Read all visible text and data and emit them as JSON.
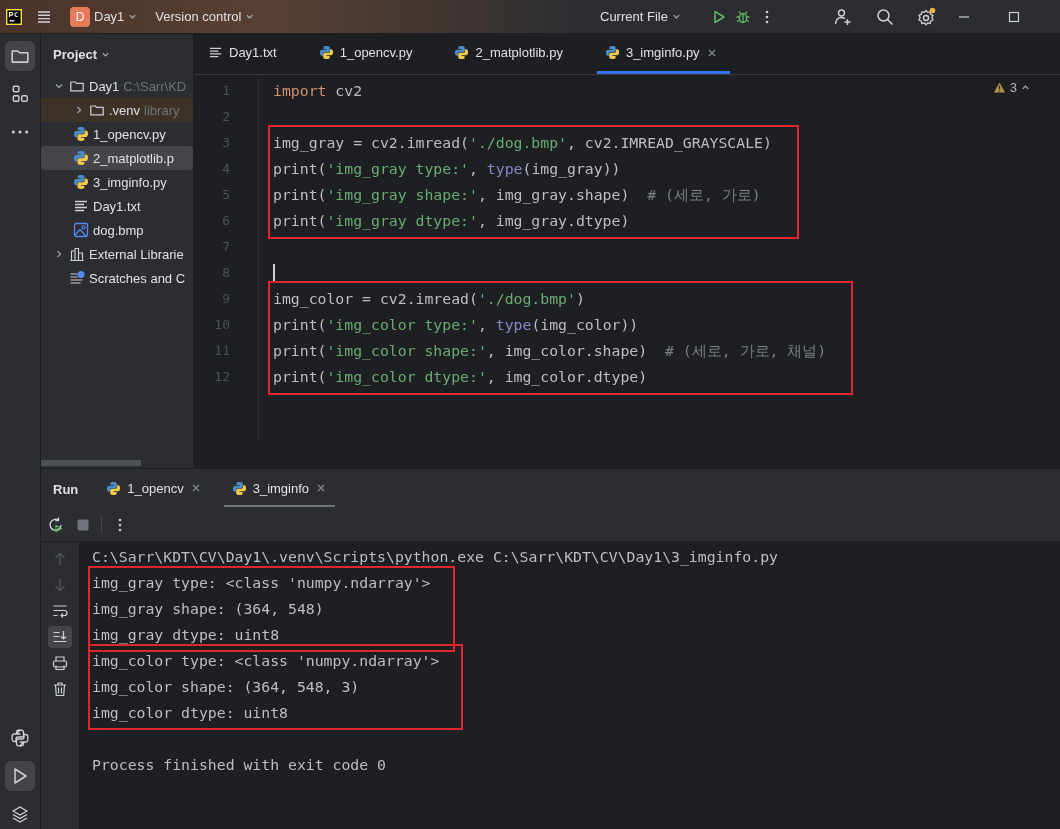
{
  "title_bar": {
    "project_initial": "D",
    "project": "Day1",
    "vcs": "Version control",
    "run_config": "Current File"
  },
  "left_toolbar": {
    "top": [
      {
        "kind": "folder",
        "selected": true
      },
      {
        "kind": "structure",
        "selected": false
      },
      {
        "kind": "more",
        "selected": false
      }
    ],
    "bottom": [
      {
        "kind": "python",
        "selected": false
      },
      {
        "kind": "run",
        "selected": true
      },
      {
        "kind": "layers",
        "selected": false
      }
    ]
  },
  "project_panel": {
    "title": "Project",
    "tree": [
      {
        "label": "Day1",
        "hint": "C:\\Sarr\\KD",
        "kind": "folder",
        "expanded": true,
        "selected": false,
        "excluded": false,
        "children": [
          {
            "label": ".venv",
            "hint": "library",
            "kind": "folder",
            "expanded": false,
            "selected": false,
            "excluded": true
          },
          {
            "label": "1_opencv.py",
            "kind": "python",
            "selected": false,
            "excluded": false
          },
          {
            "label": "2_matplotlib.p",
            "kind": "python",
            "selected": true,
            "excluded": false
          },
          {
            "label": "3_imginfo.py",
            "kind": "python",
            "selected": false,
            "excluded": false
          },
          {
            "label": "Day1.txt",
            "kind": "text",
            "selected": false,
            "excluded": false
          },
          {
            "label": "dog.bmp",
            "kind": "image",
            "selected": false,
            "excluded": false
          }
        ]
      },
      {
        "label": "External Librarie",
        "kind": "library",
        "expanded": false,
        "selected": false,
        "excluded": false
      },
      {
        "label": "Scratches and C",
        "kind": "scratch",
        "selected": false,
        "excluded": false
      }
    ]
  },
  "editor": {
    "tabs": [
      {
        "label": "Day1.txt",
        "kind": "text",
        "selected": false,
        "closable": false
      },
      {
        "label": "1_opencv.py",
        "kind": "python",
        "selected": false,
        "closable": false
      },
      {
        "label": "2_matplotlib.py",
        "kind": "python",
        "selected": false,
        "closable": false
      },
      {
        "label": "3_imginfo.py",
        "kind": "python",
        "selected": true,
        "closable": true
      }
    ],
    "warnings": "3",
    "blocks": [
      {
        "boxed": false,
        "lines": [
          {
            "number": "1",
            "cursor": false,
            "tokens": [
              {
                "kind": "keyword",
                "text": "import"
              },
              {
                "kind": "plain",
                "text": " cv2"
              }
            ]
          },
          {
            "number": "2",
            "cursor": false
          }
        ]
      },
      {
        "boxed": true,
        "lines": [
          {
            "number": "3",
            "cursor": false,
            "tokens": [
              {
                "kind": "plain",
                "text": "img_gray = cv2.imread("
              },
              {
                "kind": "string",
                "text": "'./dog.bmp'"
              },
              {
                "kind": "plain",
                "text": ", cv2.IMREAD_GRAYSCALE)"
              }
            ]
          },
          {
            "number": "4",
            "cursor": false,
            "tokens": [
              {
                "kind": "plain",
                "text": "print("
              },
              {
                "kind": "string",
                "text": "'img_gray type:'"
              },
              {
                "kind": "plain",
                "text": ", "
              },
              {
                "kind": "builtin",
                "text": "type"
              },
              {
                "kind": "plain",
                "text": "(img_gray))"
              }
            ]
          },
          {
            "number": "5",
            "cursor": false,
            "tokens": [
              {
                "kind": "plain",
                "text": "print("
              },
              {
                "kind": "string",
                "text": "'img_gray shape:'"
              },
              {
                "kind": "plain",
                "text": ", img_gray.shape)  "
              },
              {
                "kind": "comment",
                "text": "# (세로, 가로)"
              }
            ]
          },
          {
            "number": "6",
            "cursor": false,
            "tokens": [
              {
                "kind": "plain",
                "text": "print("
              },
              {
                "kind": "string",
                "text": "'img_gray dtype:'"
              },
              {
                "kind": "plain",
                "text": ", img_gray.dtype)"
              }
            ]
          }
        ]
      },
      {
        "boxed": false,
        "lines": [
          {
            "number": "7",
            "cursor": false
          },
          {
            "number": "8",
            "cursor": true
          }
        ]
      },
      {
        "boxed": true,
        "lines": [
          {
            "number": "9",
            "cursor": false,
            "tokens": [
              {
                "kind": "plain",
                "text": "img_color = cv2.imread("
              },
              {
                "kind": "string",
                "text": "'./dog.bmp'"
              },
              {
                "kind": "plain",
                "text": ")"
              }
            ]
          },
          {
            "number": "10",
            "cursor": false,
            "tokens": [
              {
                "kind": "plain",
                "text": "print("
              },
              {
                "kind": "string",
                "text": "'img_color type:'"
              },
              {
                "kind": "plain",
                "text": ", "
              },
              {
                "kind": "builtin",
                "text": "type"
              },
              {
                "kind": "plain",
                "text": "(img_color))"
              }
            ]
          },
          {
            "number": "11",
            "cursor": false,
            "tokens": [
              {
                "kind": "plain",
                "text": "print("
              },
              {
                "kind": "string",
                "text": "'img_color shape:'"
              },
              {
                "kind": "plain",
                "text": ", img_color.shape)  "
              },
              {
                "kind": "comment",
                "text": "# (세로, 가로, 채널)"
              }
            ]
          },
          {
            "number": "12",
            "cursor": false,
            "tokens": [
              {
                "kind": "plain",
                "text": "print("
              },
              {
                "kind": "string",
                "text": "'img_color dtype:'"
              },
              {
                "kind": "plain",
                "text": ", img_color.dtype)"
              }
            ]
          }
        ]
      }
    ]
  },
  "run_panel": {
    "title": "Run",
    "tabs": [
      {
        "label": "1_opencv",
        "selected": false
      },
      {
        "label": "3_imginfo",
        "selected": true
      }
    ],
    "gutter": [
      {
        "kind": "up",
        "disabled": true,
        "selected": false
      },
      {
        "kind": "down",
        "disabled": true,
        "selected": false
      },
      {
        "kind": "wrap",
        "disabled": false,
        "selected": false
      },
      {
        "kind": "scroll-end",
        "disabled": false,
        "selected": true
      },
      {
        "kind": "print",
        "disabled": false,
        "selected": false
      },
      {
        "kind": "trash",
        "disabled": false,
        "selected": false
      }
    ],
    "console": {
      "command": "C:\\Sarr\\KDT\\CV\\Day1\\.venv\\Scripts\\python.exe C:\\Sarr\\KDT\\CV\\Day1\\3_imginfo.py",
      "blocks": [
        {
          "boxed": true,
          "lines": [
            "img_gray type: <class 'numpy.ndarray'>",
            "img_gray shape: (364, 548)",
            "img_gray dtype: uint8"
          ]
        },
        {
          "boxed": true,
          "lines": [
            "img_color type: <class 'numpy.ndarray'>",
            "img_color shape: (364, 548, 3)",
            "img_color dtype: uint8"
          ]
        }
      ],
      "exit_message": "Process finished with exit code 0"
    }
  }
}
